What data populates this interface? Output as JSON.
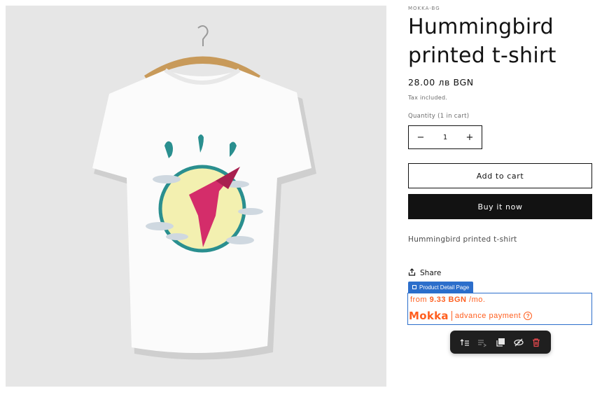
{
  "product": {
    "vendor": "MOKKA-BG",
    "title": "Hummingbird printed t-shirt",
    "price": "28.00 лв BGN",
    "tax_note": "Tax included.",
    "quantity_label": "Quantity (1 in cart)",
    "quantity_value": "1",
    "decrement_symbol": "−",
    "increment_symbol": "+",
    "add_to_cart_label": "Add to cart",
    "buy_now_label": "Buy it now",
    "description": "Hummingbird printed t-shirt",
    "share_label": "Share",
    "share_icon": "share-icon"
  },
  "widget": {
    "tag_label": "Product Detail Page",
    "from_text": "from",
    "amount": "9.33 BGN",
    "per_month": "/mo.",
    "logo_text": "Mokka",
    "advance_text": "advance payment",
    "help_symbol": "?",
    "accent_color": "#ff5f1f",
    "selection_color": "#2c6ecb"
  },
  "toolbar": {
    "items": [
      "select-parent-icon",
      "move-icon",
      "duplicate-icon",
      "hide-icon",
      "delete-icon"
    ]
  },
  "colors": {
    "button_dark": "#121212",
    "image_bg": "#e6e6e6"
  }
}
